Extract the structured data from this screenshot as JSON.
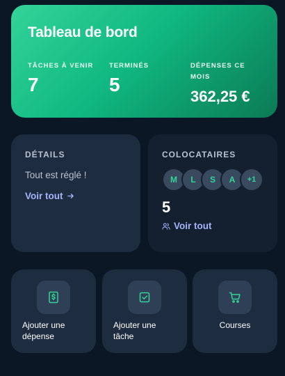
{
  "hero": {
    "title": "Tableau de bord",
    "stats": [
      {
        "label": "Tâches à venir",
        "value": "7"
      },
      {
        "label": "Terminés",
        "value": "5"
      },
      {
        "label": "Dépenses ce mois",
        "value": "362,25 €"
      }
    ]
  },
  "details": {
    "title": "Détails",
    "message": "Tout est réglé !",
    "link": "Voir tout"
  },
  "roommates": {
    "title": "Colocataires",
    "avatars": [
      "M",
      "L",
      "S",
      "A",
      "+1"
    ],
    "count": "5",
    "link": "Voir tout"
  },
  "actions": [
    {
      "label": "Ajouter une dépense",
      "icon": "dollar-receipt-icon"
    },
    {
      "label": "Ajouter une tâche",
      "icon": "checkbox-icon"
    },
    {
      "label": "Courses",
      "icon": "cart-icon"
    }
  ],
  "colors": {
    "accent": "#34d399",
    "link": "#a5b4fc",
    "background": "#0c1726",
    "card": "#1e2c40"
  }
}
